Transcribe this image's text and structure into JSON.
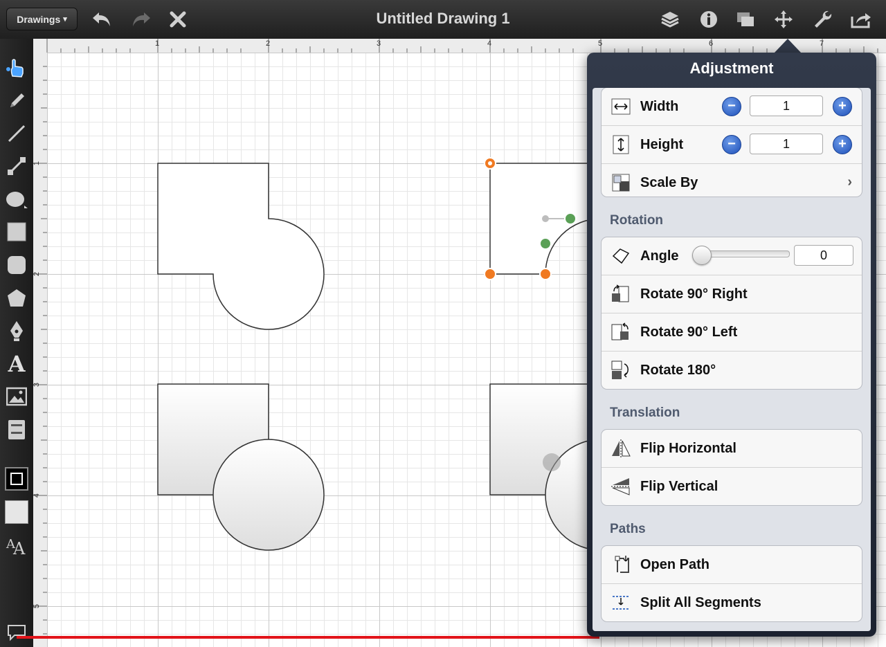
{
  "topbar": {
    "drawings_label": "Drawings",
    "drawings_caret": "▾",
    "title": "Untitled Drawing 1",
    "icons": [
      "undo-icon",
      "redo-icon",
      "close-icon",
      "layers-icon",
      "info-icon",
      "display-icon",
      "move-icon",
      "wrench-icon",
      "share-icon"
    ]
  },
  "ruler": {
    "top_labels": [
      "1",
      "2",
      "3",
      "4",
      "5",
      "6",
      "7"
    ],
    "left_labels": [
      "1",
      "2",
      "3",
      "4",
      "5"
    ]
  },
  "tools": [
    "pointer-tool",
    "pencil-tool",
    "line-tool",
    "connector-tool",
    "ellipse-tool",
    "rectangle-tool",
    "rounded-rectangle-tool",
    "polygon-tool",
    "pen-tool",
    "text-tool",
    "image-tool",
    "stencil-tool",
    "stroke-color",
    "fill-color",
    "font-size"
  ],
  "text_tool_glyph": "A",
  "panel": {
    "title": "Adjustment",
    "width": {
      "label": "Width",
      "value": "1"
    },
    "height": {
      "label": "Height",
      "value": "1"
    },
    "scale": {
      "label": "Scale By"
    },
    "rotation": {
      "section": "Rotation",
      "angle_label": "Angle",
      "angle_value": "0",
      "rotate_right": "Rotate 90° Right",
      "rotate_left": "Rotate 90° Left",
      "rotate_180": "Rotate 180°"
    },
    "translation": {
      "section": "Translation",
      "flip_h": "Flip Horizontal",
      "flip_v": "Flip Vertical"
    },
    "paths": {
      "section": "Paths",
      "open_path": "Open Path",
      "split_segments": "Split All Segments"
    }
  },
  "colors": {
    "accent_blue": "#1d4fb8",
    "handle_orange": "#f07a22",
    "handle_green": "#5aa056",
    "recording_red": "#e2141a"
  }
}
